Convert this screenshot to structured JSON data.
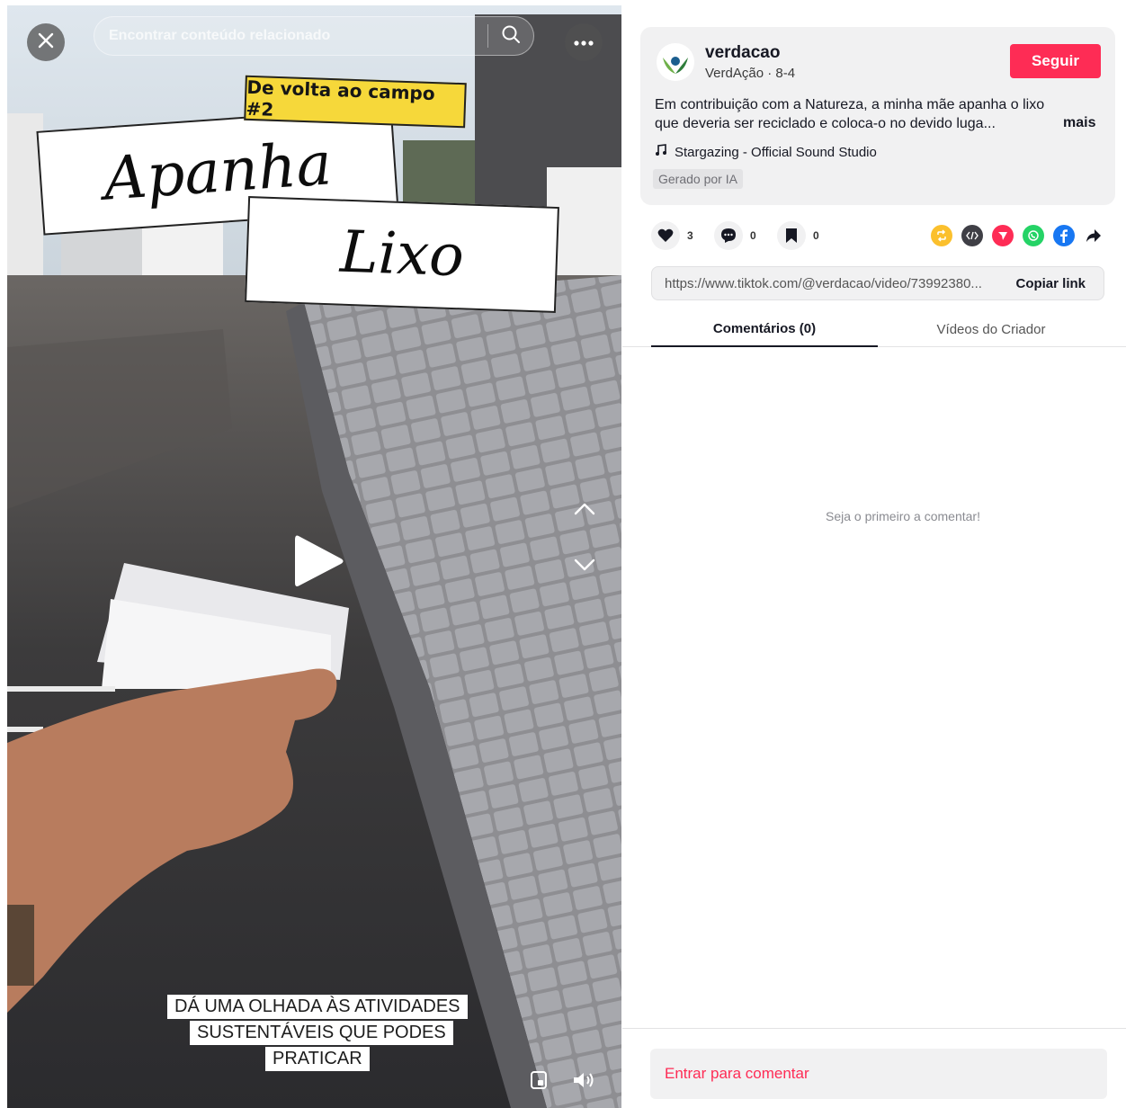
{
  "colors": {
    "accent": "#fe2c55",
    "card_bg": "#f1f1f2",
    "sticker_yellow": "#f6d83a"
  },
  "video": {
    "search_placeholder": "Encontrar conteúdo relacionado",
    "overlay": {
      "tag": "De volta ao campo #2",
      "title_word_1": "Apanha",
      "title_word_2": "Lixo"
    },
    "caption_lines": [
      "DÁ UMA OLHADA ÀS ATIVIDADES",
      "SUSTENTÁVEIS QUE PODES",
      "PRATICAR"
    ],
    "icons": {
      "close": "close-icon",
      "search": "search-icon",
      "more": "more-icon",
      "play": "play-icon",
      "previous": "chevron-up-icon",
      "next": "chevron-down-icon",
      "floating_player": "floating-player-icon",
      "volume": "volume-icon"
    }
  },
  "post": {
    "username": "verdacao",
    "display_name": "VerdAção",
    "date": "8-4",
    "subline": "VerdAção · 8-4",
    "follow_label": "Seguir",
    "description": "Em contribuição com a Natureza, a minha mãe apanha o lixo que deveria ser reciclado e coloca-o no devido luga...",
    "more_label": "mais",
    "music": "Stargazing - Official Sound Studio",
    "ai_badge": "Gerado por IA"
  },
  "stats": {
    "likes": "3",
    "comments": "0",
    "saves": "0"
  },
  "share_icons": [
    "repost-icon",
    "embed-icon",
    "send-icon",
    "whatsapp-icon",
    "facebook-icon",
    "share-arrow-icon"
  ],
  "link": {
    "url": "https://www.tiktok.com/@verdacao/video/73992380...",
    "copy_label": "Copiar link"
  },
  "tabs": [
    {
      "label": "Comentários (0)",
      "active": true
    },
    {
      "label": "Vídeos do Criador",
      "active": false
    }
  ],
  "comments": {
    "empty_text": "Seja o primeiro a comentar!",
    "login_prompt": "Entrar para comentar"
  }
}
